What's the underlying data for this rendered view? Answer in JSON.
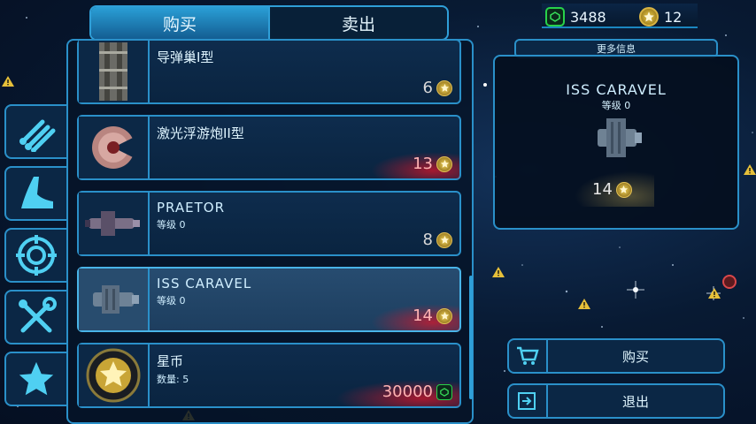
{
  "currency": {
    "cubes": "3488",
    "stars": "12"
  },
  "tabs": [
    {
      "label": "购买"
    },
    {
      "label": "卖出"
    }
  ],
  "categories": [
    {
      "icon": "pipes-icon"
    },
    {
      "icon": "boot-icon"
    },
    {
      "icon": "crosshair-icon"
    },
    {
      "icon": "tools-icon"
    },
    {
      "icon": "star-icon"
    }
  ],
  "items": [
    {
      "name": "导弹巢I型",
      "sub": "",
      "price": "6",
      "currency": "star",
      "price_style": "normal"
    },
    {
      "name": "激光浮游炮II型",
      "sub": "",
      "price": "13",
      "currency": "star",
      "price_style": "red"
    },
    {
      "name": "PRAETOR",
      "sub": "等级 0",
      "price": "8",
      "currency": "star",
      "price_style": "normal"
    },
    {
      "name": "ISS CARAVEL",
      "sub": "等级 0",
      "price": "14",
      "currency": "star",
      "price_style": "red"
    },
    {
      "name": "星币",
      "sub": "数量: 5",
      "price": "30000",
      "currency": "cube",
      "price_style": "red"
    }
  ],
  "info": {
    "header": "更多信息",
    "title": "ISS CARAVEL",
    "level": "等级 0",
    "price": "14"
  },
  "actions": {
    "buy": "购买",
    "exit": "退出"
  }
}
